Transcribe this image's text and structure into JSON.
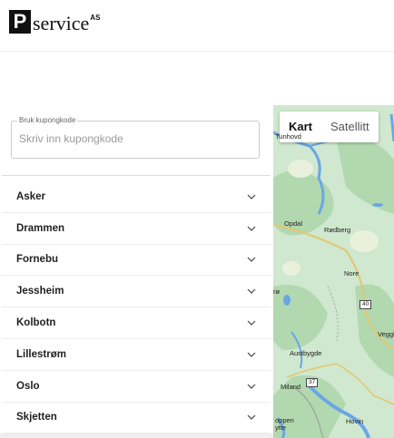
{
  "header": {
    "logo_letter": "P",
    "logo_word": "service",
    "logo_suffix": "AS"
  },
  "coupon": {
    "label": "Bruk kupongkode",
    "placeholder": "Skriv inn kupongkode",
    "value": ""
  },
  "cities": [
    {
      "label": "Asker"
    },
    {
      "label": "Drammen"
    },
    {
      "label": "Fornebu"
    },
    {
      "label": "Jessheim"
    },
    {
      "label": "Kolbotn"
    },
    {
      "label": "Lillestrøm"
    },
    {
      "label": "Oslo"
    },
    {
      "label": "Skjetten"
    }
  ],
  "map": {
    "toggle": {
      "map": "Kart",
      "satellite": "Satellitt",
      "active": "map"
    },
    "places": [
      {
        "name": "Opdal"
      },
      {
        "name": "Rødberg"
      },
      {
        "name": "Nore"
      },
      {
        "name": "Veggli"
      },
      {
        "name": "Austbygde"
      },
      {
        "name": "Miland"
      },
      {
        "name": "Hovin"
      },
      {
        "name": "oppen"
      },
      {
        "name": "ytte"
      },
      {
        "name": "rø"
      },
      {
        "name": "Tunhovd"
      }
    ],
    "road_signs": [
      "40",
      "37"
    ],
    "colors": {
      "land": "#cfe8cf",
      "forest": "#b2d8b0",
      "water": "#6aa6e6",
      "road": "#e3c76d"
    }
  }
}
